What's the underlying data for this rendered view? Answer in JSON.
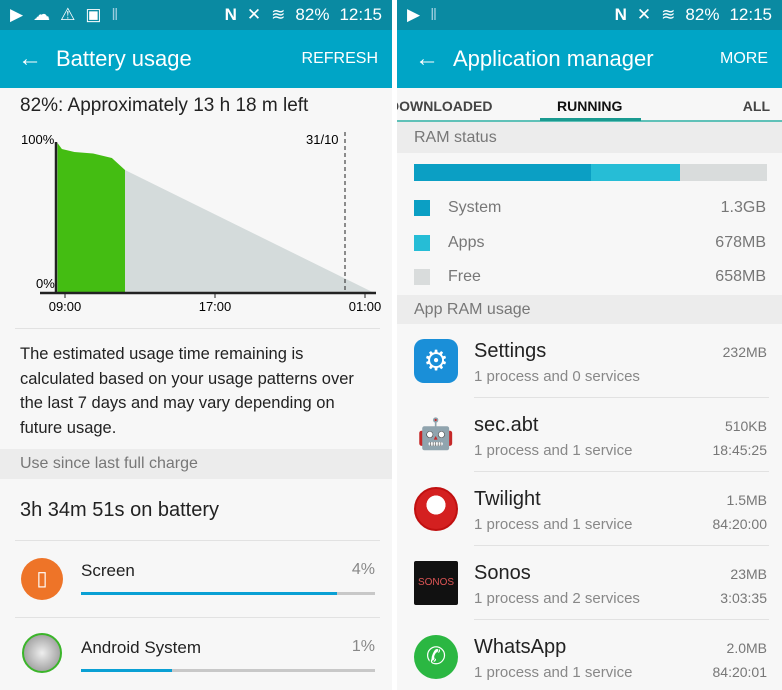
{
  "left": {
    "status": {
      "icons": [
        "play-icon",
        "cloud-icon",
        "warning-icon",
        "image-icon",
        "pause-icon",
        "nfc-icon",
        "mute-icon",
        "wifi-icon",
        "signal-icon",
        "battery-icon"
      ],
      "battery": "82%",
      "time": "12:15"
    },
    "appbar": {
      "title": "Battery usage",
      "action": "REFRESH"
    },
    "summary": "82%: Approximately 13 h 18 m left",
    "chart_data": {
      "type": "area",
      "y_ticks": [
        "100%",
        "0%"
      ],
      "x_ticks": [
        "09:00",
        "17:00",
        "01:00"
      ],
      "date_marker": "31/10",
      "ylim": [
        0,
        100
      ],
      "series": [
        {
          "kind": "actual",
          "color": "#44bd12",
          "points": [
            [
              "08:36",
              100
            ],
            [
              "08:50",
              96
            ],
            [
              "09:30",
              94
            ],
            [
              "10:30",
              93
            ],
            [
              "11:30",
              90
            ],
            [
              "12:12",
              82
            ]
          ]
        },
        {
          "kind": "projected",
          "color": "#d4dbdb",
          "points": [
            [
              "12:12",
              82
            ],
            [
              "01:30",
              0
            ]
          ]
        }
      ]
    },
    "description": "The estimated usage time remaining is calculated based on your usage patterns over the last 7 days and may vary depending on future usage.",
    "section_header": "Use since last full charge",
    "on_battery": "3h 34m 51s on battery",
    "items": [
      {
        "name": "Screen",
        "percent": "4%",
        "bar_fraction": 0.87,
        "icon": "screen-brightness-icon"
      },
      {
        "name": "Android System",
        "percent": "1%",
        "bar_fraction": 0.31,
        "icon": "android-system-icon"
      }
    ]
  },
  "right": {
    "status": {
      "icons": [
        "play-icon",
        "pause-icon",
        "nfc-icon",
        "mute-icon",
        "wifi-icon",
        "signal-icon",
        "battery-icon"
      ],
      "battery": "82%",
      "time": "12:15"
    },
    "appbar": {
      "title": "Application manager",
      "action": "MORE"
    },
    "tabs": [
      {
        "label": "DOWNLOADED"
      },
      {
        "label": "RUNNING",
        "active": true
      },
      {
        "label": "ALL"
      }
    ],
    "ram_header": "RAM status",
    "ram": [
      {
        "label": "System",
        "value": "1.3GB",
        "color": "#0b9fc4"
      },
      {
        "label": "Apps",
        "value": "678MB",
        "color": "#26bdd6"
      },
      {
        "label": "Free",
        "value": "658MB",
        "color": "#d9dcdc"
      }
    ],
    "app_header": "App RAM usage",
    "apps": [
      {
        "name": "Settings",
        "sub": "1 process and 0 services",
        "size": "232MB",
        "time": "",
        "icon": "settings-gear-icon"
      },
      {
        "name": "sec.abt",
        "sub": "1 process and 1 service",
        "size": "510KB",
        "time": "18:45:25",
        "icon": "android-robot-icon"
      },
      {
        "name": "Twilight",
        "sub": "1 process and 1 service",
        "size": "1.5MB",
        "time": "84:20:00",
        "icon": "twilight-icon"
      },
      {
        "name": "Sonos",
        "sub": "1 process and 2 services",
        "size": "23MB",
        "time": "3:03:35",
        "icon": "sonos-logo-icon",
        "logo_text": "SONOS"
      },
      {
        "name": "WhatsApp",
        "sub": "1 process and 1 service",
        "size": "2.0MB",
        "time": "84:20:01",
        "icon": "whatsapp-icon"
      }
    ]
  }
}
